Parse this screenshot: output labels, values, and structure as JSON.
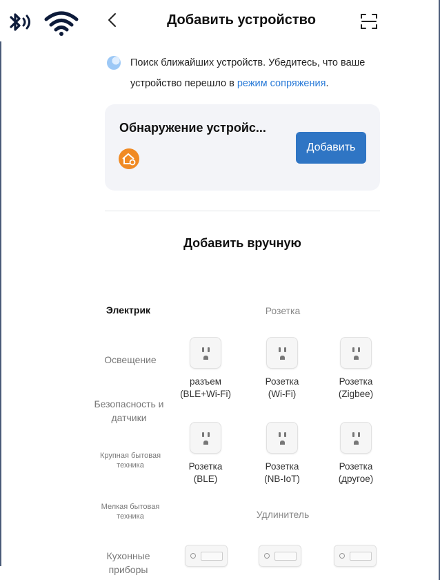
{
  "status": {
    "icons": [
      "bluetooth-icon",
      "wifi-icon"
    ]
  },
  "header": {
    "title": "Добавить устройство",
    "back_icon": "chevron-left-icon",
    "scan_icon": "scan-icon"
  },
  "search": {
    "text_before": "Поиск ближайших устройств. Убедитесь, что ваше устройство перешло в ",
    "link": "режим сопряжения",
    "text_after": "."
  },
  "discovery": {
    "title": "Обнаружение устройс...",
    "add_label": "Добавить"
  },
  "manual": {
    "title": "Добавить вручную"
  },
  "categories": [
    {
      "label": "Электрик",
      "active": true
    },
    {
      "label": "Освещение"
    },
    {
      "label": "Безопасность и датчики"
    },
    {
      "label": "Крупная бытовая техника"
    },
    {
      "label": "Мелкая бытовая техника"
    },
    {
      "label": "Кухонные приборы"
    }
  ],
  "sections": [
    {
      "title": "Розетка",
      "devices": [
        {
          "line1": "разъем",
          "line2": "(BLE+Wi-Fi)"
        },
        {
          "line1": "Розетка",
          "line2": "(Wi-Fi)"
        },
        {
          "line1": "Розетка",
          "line2": "(Zigbee)"
        },
        {
          "line1": "Розетка",
          "line2": "(BLE)"
        },
        {
          "line1": "Розетка",
          "line2": "(NB-IoT)"
        },
        {
          "line1": "Розетка",
          "line2": "(другое)"
        }
      ]
    },
    {
      "title": "Удлинитель"
    }
  ],
  "colors": {
    "accent": "#2f75c4",
    "link": "#2a7bd8",
    "card_bg": "#f3f4f8",
    "discover_icon": "#f08a24"
  }
}
